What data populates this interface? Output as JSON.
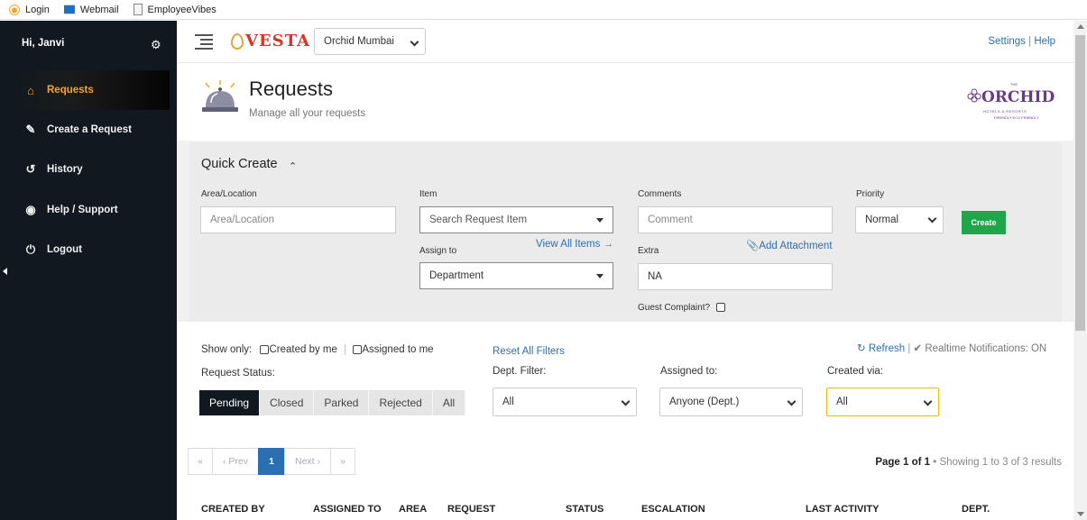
{
  "bookmarks": [
    {
      "label": "Login",
      "icon": "login-icon"
    },
    {
      "label": "Webmail",
      "icon": "mail-icon"
    },
    {
      "label": "EmployeeVibes",
      "icon": "page-icon"
    }
  ],
  "sidebar": {
    "greeting": "Hi, Janvi",
    "items": [
      {
        "label": "Requests",
        "icon": "home-icon",
        "active": true
      },
      {
        "label": "Create a Request",
        "icon": "edit-icon"
      },
      {
        "label": "History",
        "icon": "history-icon"
      },
      {
        "label": "Help / Support",
        "icon": "lifebuoy-icon"
      },
      {
        "label": "Logout",
        "icon": "power-icon"
      }
    ]
  },
  "topbar": {
    "brand": "VESTA",
    "hotel": "Orchid Mumbai",
    "settings": "Settings",
    "help": "Help",
    "separator": "|"
  },
  "page": {
    "title": "Requests",
    "subtitle": "Manage all your requests"
  },
  "hotel_logo": {
    "small": "THE",
    "name": "ORCHID",
    "tagline": "HOTELS & RESORTS",
    "tagline2": "FRIENDLY ECO FRIENDLY"
  },
  "quick_create": {
    "title": "Quick Create",
    "area_label": "Area/Location",
    "area_placeholder": "Area/Location",
    "item_label": "Item",
    "item_placeholder": "Search Request Item",
    "view_all": "View All Items →",
    "assign_label": "Assign to",
    "assign_value": "Department",
    "comments_label": "Comments",
    "comment_placeholder": "Comment",
    "add_attachment": "Add Attachment",
    "extra_label": "Extra",
    "extra_value": "NA",
    "guest_complaint": "Guest Complaint?",
    "priority_label": "Priority",
    "priority_value": "Normal",
    "create": "Create"
  },
  "filters": {
    "show_only": "Show only:",
    "created_by_me": "Created by me",
    "assigned_to_me": "Assigned to me",
    "reset": "Reset All Filters",
    "refresh": "Refresh",
    "realtime": "Realtime Notifications: ON",
    "status_label": "Request Status:",
    "status_tabs": [
      "Pending",
      "Closed",
      "Parked",
      "Rejected",
      "All"
    ],
    "dept_label": "Dept. Filter:",
    "dept_value": "All",
    "assigned_label": "Assigned to:",
    "assigned_value": "Anyone (Dept.)",
    "created_via_label": "Created via:",
    "created_via_value": "All"
  },
  "pagination": {
    "first": "«",
    "prev": "‹ Prev",
    "current": "1",
    "next": "Next ›",
    "last": "»",
    "page_info": "Page 1 of 1",
    "showing": " • Showing 1 to 3 of 3 results"
  },
  "table": {
    "columns": [
      "CREATED BY",
      "ASSIGNED TO",
      "AREA",
      "REQUEST",
      "STATUS",
      "ESCALATION",
      "LAST ACTIVITY",
      "DEPT."
    ]
  },
  "colors": {
    "sidebar_bg": "#111820",
    "accent": "#f5a623",
    "link": "#2a6fb2",
    "create_button": "#1fa64a"
  }
}
